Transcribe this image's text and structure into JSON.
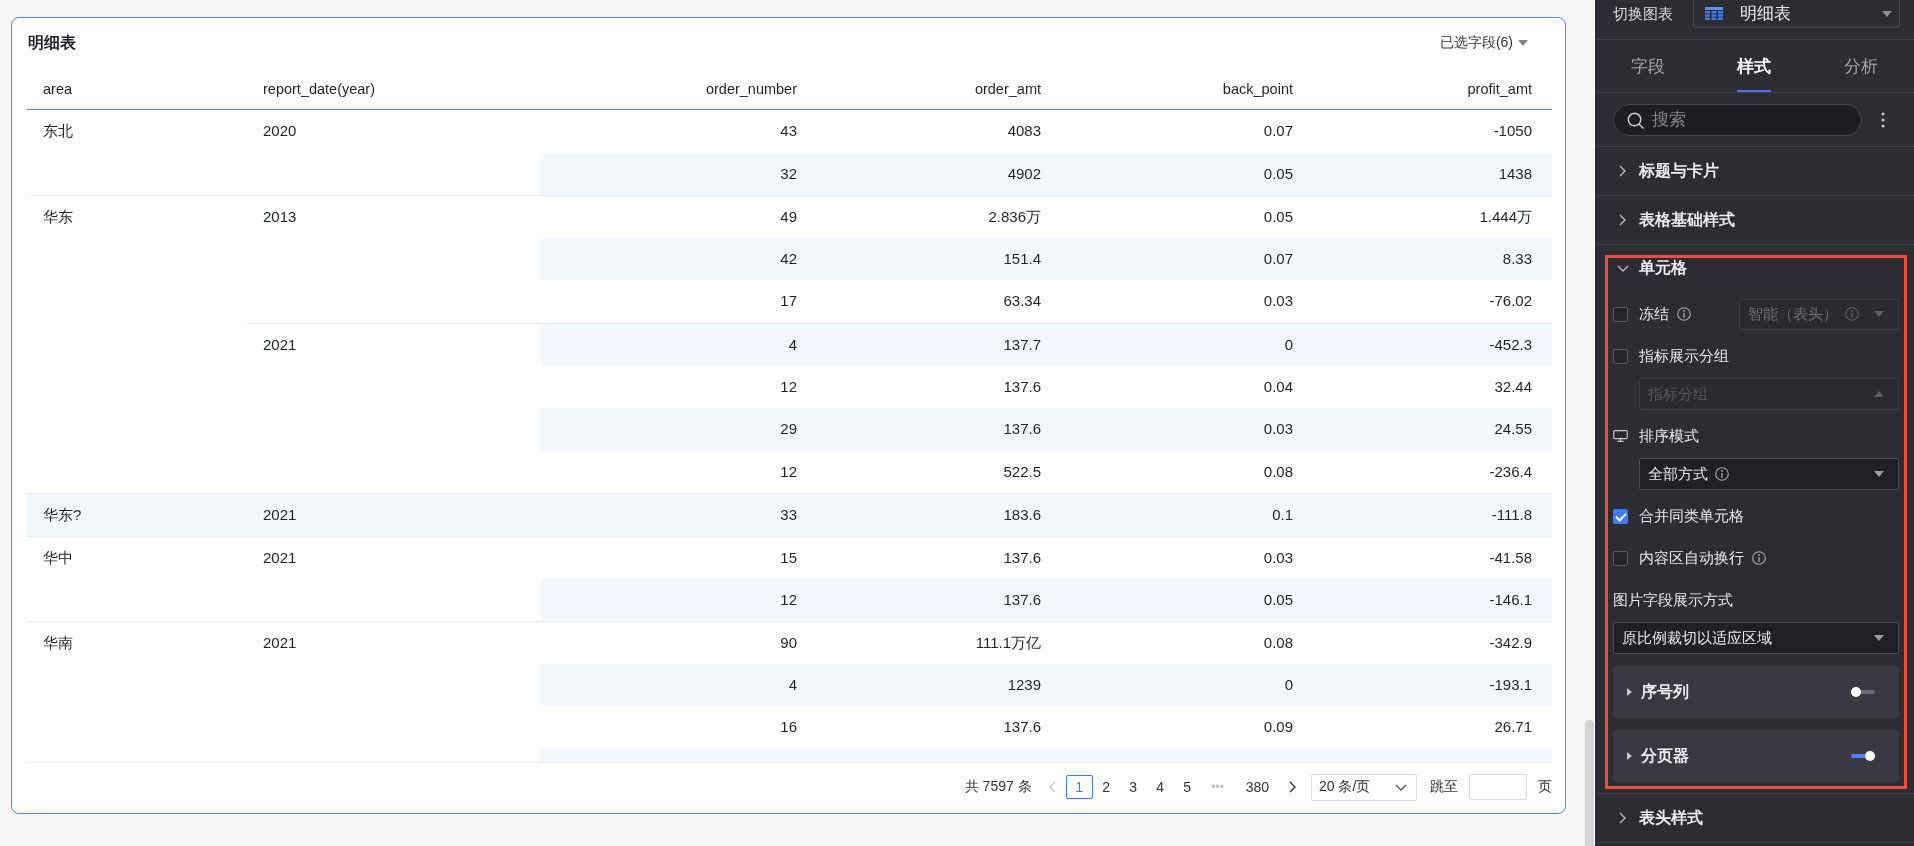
{
  "card": {
    "title": "明细表",
    "field_picker": "已选字段(6)"
  },
  "table": {
    "columns": [
      {
        "label": "area",
        "kind": "dimension"
      },
      {
        "label": "report_date(year)",
        "kind": "dimension"
      },
      {
        "label": "order_number",
        "kind": "measure"
      },
      {
        "label": "order_amt",
        "kind": "measure"
      },
      {
        "label": "back_point",
        "kind": "measure"
      },
      {
        "label": "profit_amt",
        "kind": "measure"
      }
    ],
    "groups": [
      {
        "area": "东北",
        "years": [
          {
            "year": "2020",
            "rows": [
              [
                "43",
                "4083",
                "0.07",
                "-1050"
              ],
              [
                "32",
                "4902",
                "0.05",
                "1438"
              ]
            ]
          }
        ]
      },
      {
        "area": "华东",
        "years": [
          {
            "year": "2013",
            "rows": [
              [
                "49",
                "2.836万",
                "0.05",
                "1.444万"
              ],
              [
                "42",
                "151.4",
                "0.07",
                "8.33"
              ],
              [
                "17",
                "63.34",
                "0.03",
                "-76.02"
              ]
            ]
          },
          {
            "year": "2021",
            "rows": [
              [
                "4",
                "137.7",
                "0",
                "-452.3"
              ],
              [
                "12",
                "137.6",
                "0.04",
                "32.44"
              ],
              [
                "29",
                "137.6",
                "0.03",
                "24.55"
              ],
              [
                "12",
                "522.5",
                "0.08",
                "-236.4"
              ]
            ]
          }
        ]
      },
      {
        "area": "华东?",
        "years": [
          {
            "year": "2021",
            "rows": [
              [
                "33",
                "183.6",
                "0.1",
                "-111.8"
              ]
            ]
          }
        ]
      },
      {
        "area": "华中",
        "years": [
          {
            "year": "2021",
            "rows": [
              [
                "15",
                "137.6",
                "0.03",
                "-41.58"
              ],
              [
                "12",
                "137.6",
                "0.05",
                "-146.1"
              ]
            ]
          }
        ]
      },
      {
        "area": "华南",
        "years": [
          {
            "year": "2021",
            "rows": [
              [
                "90",
                "111.1万亿",
                "0.08",
                "-342.9"
              ],
              [
                "4",
                "1239",
                "0",
                "-193.1"
              ],
              [
                "16",
                "137.6",
                "0.09",
                "26.71"
              ]
            ]
          }
        ]
      }
    ]
  },
  "pagination": {
    "total": "共 7597 条",
    "prev": {
      "disabled": true
    },
    "pages": [
      {
        "kind": "page",
        "label": "1",
        "selected": true
      },
      {
        "kind": "page",
        "label": "2",
        "selected": false
      },
      {
        "kind": "page",
        "label": "3",
        "selected": false
      },
      {
        "kind": "page",
        "label": "4",
        "selected": false
      },
      {
        "kind": "page",
        "label": "5",
        "selected": false
      },
      {
        "kind": "ellipsis",
        "label": "•••",
        "selected": false
      },
      {
        "kind": "page",
        "label": "380",
        "selected": false
      }
    ],
    "next": {
      "disabled": false
    },
    "page_size": "20 条/页",
    "jump_label": "跳至",
    "jump_suffix": "页"
  },
  "panel": {
    "chart_switch": {
      "label": "切换图表",
      "value": "明细表"
    },
    "tabs": [
      {
        "label": "字段",
        "selected": false
      },
      {
        "label": "样式",
        "selected": true
      },
      {
        "label": "分析",
        "selected": false
      }
    ],
    "search": {
      "placeholder": "搜索"
    },
    "sections": [
      {
        "title": "标题与卡片",
        "expanded": false
      },
      {
        "title": "表格基础样式",
        "expanded": false
      },
      {
        "title": "单元格",
        "expanded": true,
        "highlighted": true,
        "items": [
          {
            "kind": "checkbox",
            "label": "冻结",
            "checked": false,
            "info": true,
            "select": {
              "kind": "select",
              "value": "智能（表头）",
              "info": true,
              "disabled": true,
              "expanded": false
            }
          },
          {
            "kind": "checkbox",
            "label": "指标展示分组",
            "checked": false,
            "children": [
              {
                "kind": "select",
                "placeholder": "指标分组",
                "disabled": true,
                "expanded": true
              }
            ]
          },
          {
            "kind": "label",
            "label": "排序模式",
            "icon": true,
            "children": [
              {
                "kind": "select",
                "value": "全部方式",
                "info": true,
                "disabled": false,
                "expanded": false
              }
            ]
          },
          {
            "kind": "checkbox",
            "label": "合并同类单元格",
            "checked": true
          },
          {
            "kind": "checkbox",
            "label": "内容区自动换行",
            "checked": false,
            "info": true
          },
          {
            "kind": "label",
            "label": "图片字段展示方式",
            "children": [
              {
                "kind": "select",
                "value": "原比例裁切以适应区域",
                "disabled": false,
                "expanded": false
              }
            ]
          },
          {
            "kind": "toggle_panel",
            "label": "序号列",
            "expanded": false,
            "on": false
          },
          {
            "kind": "toggle_panel",
            "label": "分页器",
            "expanded": false,
            "on": true
          }
        ]
      },
      {
        "title": "表头样式",
        "expanded": false
      }
    ]
  }
}
